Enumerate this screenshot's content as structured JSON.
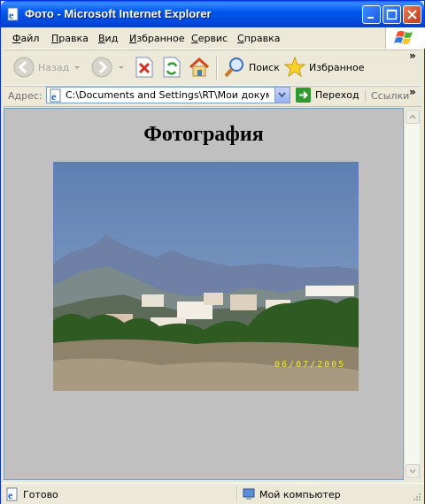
{
  "window": {
    "title": "Фото - Microsoft Internet Explorer"
  },
  "menu": {
    "items": [
      {
        "label": "Файл",
        "accel": "Ф",
        "rest": "айл"
      },
      {
        "label": "Правка",
        "accel": "П",
        "rest": "равка"
      },
      {
        "label": "Вид",
        "accel": "В",
        "rest": "ид"
      },
      {
        "label": "Избранное",
        "accel": "И",
        "rest": "збранное"
      },
      {
        "label": "Сервис",
        "accel": "С",
        "rest": "ервис"
      },
      {
        "label": "Справка",
        "accel": "С",
        "rest": "правка"
      }
    ]
  },
  "toolbar": {
    "back_label": "Назад",
    "search_label": "Поиск",
    "favorites_label": "Избранное",
    "more": "»"
  },
  "address": {
    "label": "Адрес:",
    "value": "C:\\Documents and Settings\\RT\\Мои документы\\",
    "go_label": "Переход",
    "links_label": "Ссылки",
    "more": "»"
  },
  "page": {
    "heading": "Фотография",
    "photo_date": "06/07/2005"
  },
  "status": {
    "text": "Готово",
    "zone": "Мой компьютер"
  },
  "colors": {
    "titlebar": "#0058EE",
    "page_background": "#C0C0C0",
    "chrome": "#ECE9D8"
  }
}
